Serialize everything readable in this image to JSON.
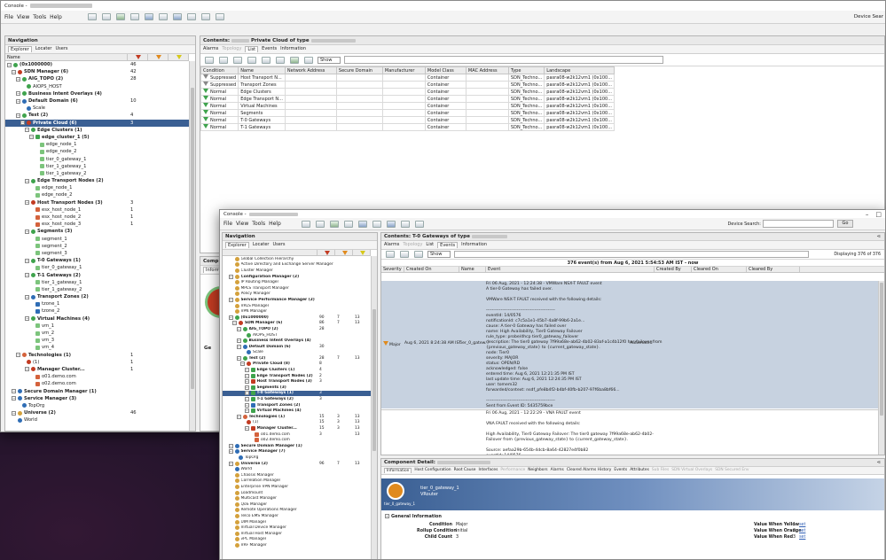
{
  "win1": {
    "title": "Console - ",
    "menu": [
      "File",
      "View",
      "Tools",
      "Help"
    ],
    "device_search_label": "Device Sear",
    "nav": {
      "title": "Navigation",
      "tabs": [
        "Explorer",
        "Locater",
        "Users"
      ],
      "col_name": "Name",
      "tree": [
        {
          "label": "(0x1000000)",
          "n1": "46",
          "n2": "",
          "n3": "",
          "lvl": 0,
          "icon": "#3fa34d",
          "bold": true
        },
        {
          "label": "SDN Manager (6)",
          "n1": "42",
          "lvl": 1,
          "icon": "#c23b22",
          "bold": true
        },
        {
          "label": "AIG_TOPO (2)",
          "n1": "28",
          "lvl": 2,
          "icon": "#3fa34d",
          "bold": true
        },
        {
          "label": "AIOPS_HOST",
          "lvl": 3,
          "icon": "#3fa34d"
        },
        {
          "label": "Business Intent Overlays (4)",
          "lvl": 2,
          "icon": "#3fa34d",
          "bold": true
        },
        {
          "label": "Default Domain (6)",
          "n1": "10",
          "lvl": 2,
          "icon": "#2f6db5",
          "bold": true
        },
        {
          "label": "Scale",
          "lvl": 3,
          "icon": "#2f6db5"
        },
        {
          "label": "Test (2)",
          "n1": "4",
          "lvl": 2,
          "icon": "#3fa34d",
          "bold": true
        },
        {
          "label": "Private Cloud (6)",
          "n1": "3",
          "lvl": 3,
          "icon": "#c23b22",
          "bold": true,
          "sel": true
        },
        {
          "label": "Edge Clusters (1)",
          "lvl": 4,
          "icon": "#3fa34d",
          "bold": true
        },
        {
          "label": "edge_cluster_1 (5)",
          "lvl": 5,
          "icon": "#3fa34d",
          "bold": true
        },
        {
          "label": "edge_node_1",
          "lvl": 6,
          "icon": "#7cc47c"
        },
        {
          "label": "edge_node_2",
          "lvl": 6,
          "icon": "#7cc47c"
        },
        {
          "label": "tier_0_gateway_1",
          "lvl": 6,
          "icon": "#7cc47c"
        },
        {
          "label": "tier_1_gateway_1",
          "lvl": 6,
          "icon": "#7cc47c"
        },
        {
          "label": "tier_1_gateway_2",
          "lvl": 6,
          "icon": "#7cc47c"
        },
        {
          "label": "Edge Transport Nodes (2)",
          "lvl": 4,
          "icon": "#3fa34d",
          "bold": true
        },
        {
          "label": "edge_node_1",
          "lvl": 5,
          "icon": "#7cc47c"
        },
        {
          "label": "edge_node_2",
          "lvl": 5,
          "icon": "#7cc47c"
        },
        {
          "label": "Host Transport Nodes (3)",
          "n1": "3",
          "lvl": 4,
          "icon": "#c23b22",
          "bold": true
        },
        {
          "label": "esx_host_node_1",
          "n1": "1",
          "lvl": 5,
          "icon": "#d4623c"
        },
        {
          "label": "esx_host_node_2",
          "n1": "1",
          "lvl": 5,
          "icon": "#d4623c"
        },
        {
          "label": "esx_host_node_3",
          "n1": "1",
          "lvl": 5,
          "icon": "#d4623c"
        },
        {
          "label": "Segments (3)",
          "lvl": 4,
          "icon": "#3fa34d",
          "bold": true
        },
        {
          "label": "segment_1",
          "lvl": 5,
          "icon": "#7cc47c"
        },
        {
          "label": "segment_2",
          "lvl": 5,
          "icon": "#7cc47c"
        },
        {
          "label": "segment_3",
          "lvl": 5,
          "icon": "#7cc47c"
        },
        {
          "label": "T-0 Gateways (1)",
          "lvl": 4,
          "icon": "#3fa34d",
          "bold": true
        },
        {
          "label": "tier_0_gateway_1",
          "lvl": 5,
          "icon": "#7cc47c"
        },
        {
          "label": "T-1 Gateways (2)",
          "lvl": 4,
          "icon": "#3fa34d",
          "bold": true
        },
        {
          "label": "tier_1_gateway_1",
          "lvl": 5,
          "icon": "#7cc47c"
        },
        {
          "label": "tier_1_gateway_2",
          "lvl": 5,
          "icon": "#7cc47c"
        },
        {
          "label": "Transport Zones (2)",
          "lvl": 4,
          "icon": "#2f6db5",
          "bold": true
        },
        {
          "label": "tzone_1",
          "lvl": 5,
          "icon": "#2f6db5"
        },
        {
          "label": "tzone_2",
          "lvl": 5,
          "icon": "#2f6db5"
        },
        {
          "label": "Virtual Machines (4)",
          "lvl": 4,
          "icon": "#3fa34d",
          "bold": true
        },
        {
          "label": "vm_1",
          "lvl": 5,
          "icon": "#7cc47c"
        },
        {
          "label": "vm_2",
          "lvl": 5,
          "icon": "#7cc47c"
        },
        {
          "label": "vm_3",
          "lvl": 5,
          "icon": "#7cc47c"
        },
        {
          "label": "vm_4",
          "lvl": 5,
          "icon": "#7cc47c"
        },
        {
          "label": "Technologies (1)",
          "n1": "1",
          "lvl": 2,
          "icon": "#d4623c",
          "bold": true
        },
        {
          "label": "(1)",
          "n1": "1",
          "lvl": 3,
          "icon": "#c23b22"
        },
        {
          "label": "Manager Cluster...",
          "n1": "1",
          "lvl": 4,
          "icon": "#c23b22",
          "bold": true
        },
        {
          "label": "o01.demo.com",
          "lvl": 5,
          "icon": "#d4623c"
        },
        {
          "label": "o02.demo.com",
          "lvl": 5,
          "icon": "#d4623c"
        },
        {
          "label": "Secure Domain Manager (1)",
          "lvl": 1,
          "icon": "#2f6db5",
          "bold": true
        },
        {
          "label": "Service Manager (3)",
          "lvl": 1,
          "icon": "#2f6db5",
          "bold": true
        },
        {
          "label": "TopOrg",
          "lvl": 2,
          "icon": "#2f6db5"
        },
        {
          "label": "Universe (2)",
          "n1": "46",
          "lvl": 1,
          "icon": "#d4a13c",
          "bold": true
        },
        {
          "label": "World",
          "lvl": 1,
          "icon": "#2f6db5"
        }
      ]
    },
    "contents": {
      "title": "Contents:",
      "title_suffix": "Private Cloud of type",
      "tabs": [
        "Alarms",
        "Topology",
        "List",
        "Events",
        "Information"
      ],
      "show_label": "Show",
      "columns": [
        "Condition",
        "Name",
        "Network Address",
        "Secure Domain",
        "Manufacturer",
        "Model Class",
        "MAC Address",
        "Type",
        "Landscape"
      ],
      "rows": [
        [
          "Suppressed",
          "Host Transport N...",
          "",
          "",
          "",
          "Container",
          "",
          "SDN_Techno...",
          "pasra08-w2k12vm1 (0x100..."
        ],
        [
          "Suppressed",
          "Transport Zones",
          "",
          "",
          "",
          "Container",
          "",
          "SDN_Techno...",
          "pasra08-w2k12vm1 (0x100..."
        ],
        [
          "Normal",
          "Edge Clusters",
          "",
          "",
          "",
          "Container",
          "",
          "SDN_Techno...",
          "pasra08-w2k12vm1 (0x100..."
        ],
        [
          "Normal",
          "Edge Transport N...",
          "",
          "",
          "",
          "Container",
          "",
          "SDN_Techno...",
          "pasra08-w2k12vm1 (0x100..."
        ],
        [
          "Normal",
          "Virtual Machines",
          "",
          "",
          "",
          "Container",
          "",
          "SDN_Techno...",
          "pasra08-w2k12vm1 (0x100..."
        ],
        [
          "Normal",
          "Segments",
          "",
          "",
          "",
          "Container",
          "",
          "SDN_Techno...",
          "pasra08-w2k12vm1 (0x100..."
        ],
        [
          "Normal",
          "T-0 Gateways",
          "",
          "",
          "",
          "Container",
          "",
          "SDN_Techno...",
          "pasra08-w2k12vm1 (0x100..."
        ],
        [
          "Normal",
          "T-1 Gateways",
          "",
          "",
          "",
          "Container",
          "",
          "SDN_Techno...",
          "pasra08-w2k12vm1 (0x100..."
        ]
      ]
    },
    "comp_label": "Comp",
    "infor_label": "Inform",
    "gen_label": "Ge"
  },
  "win2": {
    "title": "Console - ",
    "menu": [
      "File",
      "View",
      "Tools",
      "Help"
    ],
    "device_search_label": "Device Search:",
    "go_label": "Go",
    "nav": {
      "title": "Navigation",
      "tabs": [
        "Explorer",
        "Locater",
        "Users"
      ],
      "tree": [
        {
          "label": "Global Collection Hierarchy",
          "lvl": 1,
          "icon": "#d4a13c"
        },
        {
          "label": "Active Directory and Exchange Server Manager",
          "lvl": 1,
          "icon": "#d4a13c"
        },
        {
          "label": "Cluster Manager",
          "lvl": 1,
          "icon": "#d4a13c"
        },
        {
          "label": "Configuration Manager (2)",
          "lvl": 1,
          "icon": "#d4a13c",
          "bold": true
        },
        {
          "label": "IP Routing Manager",
          "lvl": 1,
          "icon": "#d4a13c"
        },
        {
          "label": "MPLS Transport Manager",
          "lvl": 1,
          "icon": "#d4a13c"
        },
        {
          "label": "Policy Manager",
          "lvl": 1,
          "icon": "#d4a13c"
        },
        {
          "label": "Service Performance Manager (2)",
          "lvl": 1,
          "icon": "#d4a13c",
          "bold": true
        },
        {
          "label": "VRLS Manager",
          "lvl": 1,
          "icon": "#d4a13c"
        },
        {
          "label": "VPN Manager",
          "lvl": 1,
          "icon": "#d4a13c"
        },
        {
          "label": "(0x1000000)",
          "n1": "90",
          "n2": "7",
          "n3": "13",
          "lvl": 1,
          "icon": "#3fa34d",
          "bold": true
        },
        {
          "label": "SDN Manager (6)",
          "n1": "86",
          "n2": "7",
          "n3": "13",
          "lvl": 2,
          "icon": "#c23b22",
          "bold": true
        },
        {
          "label": "AIG_TOPO (2)",
          "n1": "28",
          "lvl": 3,
          "icon": "#3fa34d",
          "bold": true
        },
        {
          "label": "AIOPS_HOST",
          "lvl": 4,
          "icon": "#3fa34d"
        },
        {
          "label": "Business Intent Overlays (4)",
          "lvl": 3,
          "icon": "#3fa34d",
          "bold": true
        },
        {
          "label": "Default Domain (6)",
          "n1": "30",
          "lvl": 3,
          "icon": "#2f6db5",
          "bold": true
        },
        {
          "label": "Scale",
          "lvl": 4,
          "icon": "#2f6db5"
        },
        {
          "label": "Test (2)",
          "n1": "28",
          "n2": "7",
          "n3": "13",
          "lvl": 3,
          "icon": "#3fa34d",
          "bold": true
        },
        {
          "label": "Private Cloud (8)",
          "n1": "8",
          "lvl": 4,
          "icon": "#c23b22",
          "bold": true
        },
        {
          "label": "Edge Clusters (1)",
          "n1": "4",
          "lvl": 5,
          "icon": "#3fa34d",
          "bold": true
        },
        {
          "label": "Edge Transport Nodes (2)",
          "n1": "2",
          "lvl": 5,
          "icon": "#3fa34d",
          "bold": true
        },
        {
          "label": "Host Transport Nodes (3)",
          "n1": "3",
          "lvl": 5,
          "icon": "#c23b22",
          "bold": true
        },
        {
          "label": "Segments (3)",
          "lvl": 5,
          "icon": "#3fa34d",
          "bold": true
        },
        {
          "label": "T-0 Gateways (1)",
          "n1": "3",
          "lvl": 5,
          "icon": "#3fa34d",
          "bold": true,
          "sel": true
        },
        {
          "label": "T-1 Gateways (2)",
          "n1": "3",
          "lvl": 5,
          "icon": "#3fa34d",
          "bold": true
        },
        {
          "label": "Transport Zones (2)",
          "lvl": 5,
          "icon": "#2f6db5",
          "bold": true
        },
        {
          "label": "Virtual Machines (4)",
          "lvl": 5,
          "icon": "#3fa34d",
          "bold": true
        },
        {
          "label": "Technologies (1)",
          "n1": "15",
          "n2": "3",
          "n3": "13",
          "lvl": 3,
          "icon": "#d4623c",
          "bold": true
        },
        {
          "label": "(1)",
          "n1": "15",
          "n2": "3",
          "n3": "13",
          "lvl": 4,
          "icon": "#c23b22"
        },
        {
          "label": "Manager Cluster...",
          "n1": "15",
          "n2": "3",
          "n3": "13",
          "lvl": 5,
          "icon": "#c23b22",
          "bold": true
        },
        {
          "label": "o01.demo.com",
          "n1": "3",
          "n3": "13",
          "lvl": 6,
          "icon": "#d4623c"
        },
        {
          "label": "o02.demo.com",
          "lvl": 6,
          "icon": "#d4623c"
        },
        {
          "label": "Secure Domain Manager (1)",
          "lvl": 1,
          "icon": "#2f6db5",
          "bold": true
        },
        {
          "label": "Service Manager (7)",
          "lvl": 1,
          "icon": "#2f6db5",
          "bold": true
        },
        {
          "label": "TopOrg",
          "lvl": 2,
          "icon": "#2f6db5"
        },
        {
          "label": "Universe (2)",
          "n1": "96",
          "n2": "7",
          "n3": "13",
          "lvl": 1,
          "icon": "#d4a13c",
          "bold": true
        },
        {
          "label": "World",
          "lvl": 1,
          "icon": "#2f6db5"
        },
        {
          "label": "Chassis Manager",
          "lvl": 1,
          "icon": "#d4a13c"
        },
        {
          "label": "Correlation Manager",
          "lvl": 1,
          "icon": "#d4a13c"
        },
        {
          "label": "Enterprise VPN Manager",
          "lvl": 1,
          "icon": "#d4a13c"
        },
        {
          "label": "Loadmount",
          "lvl": 1,
          "icon": "#d4a13c"
        },
        {
          "label": "Multicast Manager",
          "lvl": 1,
          "icon": "#d4a13c"
        },
        {
          "label": "QoS Manager",
          "lvl": 1,
          "icon": "#d4a13c"
        },
        {
          "label": "Remote Operations Manager",
          "lvl": 1,
          "icon": "#d4a13c"
        },
        {
          "label": "Telco EMS Manager",
          "lvl": 1,
          "icon": "#d4a13c"
        },
        {
          "label": "UIM Manager",
          "lvl": 1,
          "icon": "#d4a13c"
        },
        {
          "label": "Virtual Device Manager",
          "lvl": 1,
          "icon": "#d4a13c"
        },
        {
          "label": "Virtual Host Manager",
          "lvl": 1,
          "icon": "#d4a13c"
        },
        {
          "label": "vPC Manager",
          "lvl": 1,
          "icon": "#d4a13c"
        },
        {
          "label": "VRF Manager",
          "lvl": 1,
          "icon": "#d4a13c"
        }
      ]
    },
    "contents": {
      "title": "Contents:",
      "title_suffix": "T-0 Gateways of type",
      "tabs": [
        "Alarms",
        "Topology",
        "List",
        "Events",
        "Information"
      ],
      "show_label": "Show",
      "summary": "376 event(s) from Aug 6, 2021 5:54:53 AM IST - now",
      "displaying": "Displaying 376 of 376",
      "columns": [
        "Severity",
        "Created On",
        "Name",
        "Event",
        "Created By",
        "Cleared On",
        "Cleared By"
      ],
      "event1": {
        "severity": "Major",
        "created_on": "Aug 6, 2021 8:24:38 AM IST",
        "name": "tier_0_gatew...",
        "created_by": "Automated",
        "lines": [
          "Fri 06 Aug, 2021 - 12:24:38 - VMWare NSX-T FAULT event",
          "A tier-0 Gateway has failed over.",
          "",
          "VMWare NSX-T FAULT received with the following details:",
          "",
          "-----------------------------------------------",
          "eventId: 14/0576",
          "notificationId: c7c5a1e1-45b7-4a8f-99b6-2a1e...",
          "cause: A tier-0 Gateway has failed over",
          "name: High Availability, Tier0 Gateway Failover",
          "rule_type: probe/dhcp tier0_gateway_failover",
          "description: The tier0 gateway 7f99a68e-ab62-4b02-83af-a1c4b12f0 has failover from",
          "{previous_gateway_state} to {current_gateway_state}.",
          "node: Tier0",
          "severity: MAJOR",
          "status: OPEN/RD",
          "acknowledged: false",
          "entered time: Aug 6, 2021 12:21:35 PM IST",
          "last update time: Aug 6, 2021 12:24:35 PM IST",
          "user: tomem32",
          "forwarded/context: nsdf_pfe8b4f2-b4bf-40fb-b207-97f6ba8bf66...",
          "",
          "-----------------------------------------------",
          "Sent from Event ID: 5435759bce"
        ]
      },
      "event2": {
        "lines": [
          "Fri 06 Aug, 2021 - 12:22:29 - VNA FAULT event",
          "",
          "VNA FAULT received with the following details:",
          "",
          "High Availability, Tier0 Gateway Failover: The tier0 gateway 7f99a68e-ab62-4b02-",
          "Failover from {previous_gateway_state} to {current_gateway_state}.",
          "",
          "Source: aefaa29b-654b-4dcb-8a64-42827e4f0b82",
          "eventId: 14/0576",
          "notificationId: aefaa29b-654b-4dcb-8a64-42827e4f0b82",
          "cause: A tier-0 Gateway has failed over."
        ]
      }
    },
    "detail": {
      "title": "Component Detail:",
      "tabs": [
        "Information",
        "Host Configuration",
        "Root Cause",
        "Interfaces",
        "Performance",
        "Neighbors",
        "Alarms",
        "Cleared Alarms History",
        "Events",
        "Attributes",
        "Sub Files",
        "SDN Virtual Overlays",
        "SDN Secured Env"
      ],
      "node_name": "tier_0_gateway_1",
      "node_type": "VRouter",
      "node_caption": "tier_0_gateway_1\nVRouter",
      "section": "General Information",
      "fields": [
        {
          "label": "Condition",
          "value": "Major"
        },
        {
          "label": "Rollup Condition",
          "value": "Initial"
        },
        {
          "label": "Child Count",
          "value": "3"
        }
      ],
      "right_fields": [
        {
          "label": "Value When Yellow",
          "value": "1",
          "link": "set"
        },
        {
          "label": "Value When Orange",
          "value": "2",
          "link": "set"
        },
        {
          "label": "Value When Red",
          "value": "3",
          "link": "set"
        }
      ]
    }
  },
  "colors": {
    "selected_row": "#3a5f93",
    "red": "#c23b22",
    "orange": "#e08a1e",
    "yellow": "#d6c81a",
    "event_bg": "#c7d2e0"
  }
}
